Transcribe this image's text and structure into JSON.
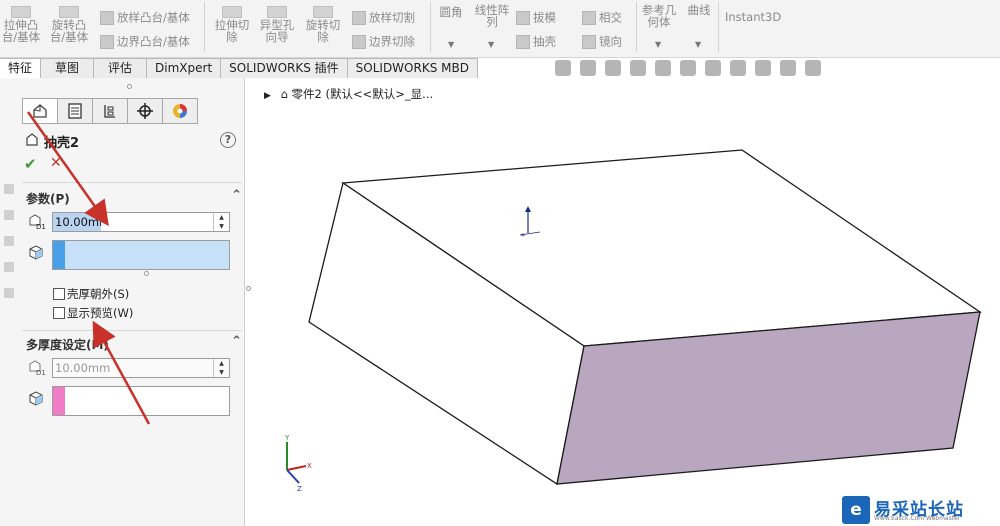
{
  "ribbon": {
    "extrude_boss": "拉伸凸\n台/基体",
    "revolve_boss": "旋转凸\n台/基体",
    "loft_boss": "放样凸台/基体",
    "boundary_boss": "边界凸台/基体",
    "extrude_cut": "拉伸切\n除",
    "hole_wizard": "异型孔\n向导",
    "revolve_cut": "旋转切\n除",
    "loft_cut": "放样切割",
    "boundary_cut": "边界切除",
    "fillet": "圆角",
    "linear_pattern": "线性阵\n列",
    "draft": "拔模",
    "shell": "抽壳",
    "intersect": "相交",
    "mirror": "镜向",
    "ref_geometry": "参考几\n何体",
    "curves": "曲线",
    "instant3d": "Instant3D"
  },
  "tabs": [
    "特征",
    "草图",
    "评估",
    "DimXpert",
    "SOLIDWORKS 插件",
    "SOLIDWORKS MBD"
  ],
  "panel": {
    "feature_title": "抽壳2",
    "help": "?",
    "params_header": "参数(P)",
    "thickness_value": "10.00mm",
    "shell_outward_label": "壳厚朝外(S)",
    "show_preview_label": "显示预览(W)",
    "multi_header": "多厚度设定(M)",
    "multi_thickness_value": "10.00mm"
  },
  "viewport": {
    "tree_text": "零件2  (默认<<默认>_显..."
  },
  "watermark": {
    "text": "易采站长站",
    "sub": "Www.Easck.Com  Webmaster"
  },
  "colors": {
    "selection_fill": "#c6e1f7",
    "selection_bar": "#4aa0e8",
    "face2_bar": "#f07cc7",
    "box_side": "#b9a6bf",
    "arrow": "#c8322a"
  }
}
